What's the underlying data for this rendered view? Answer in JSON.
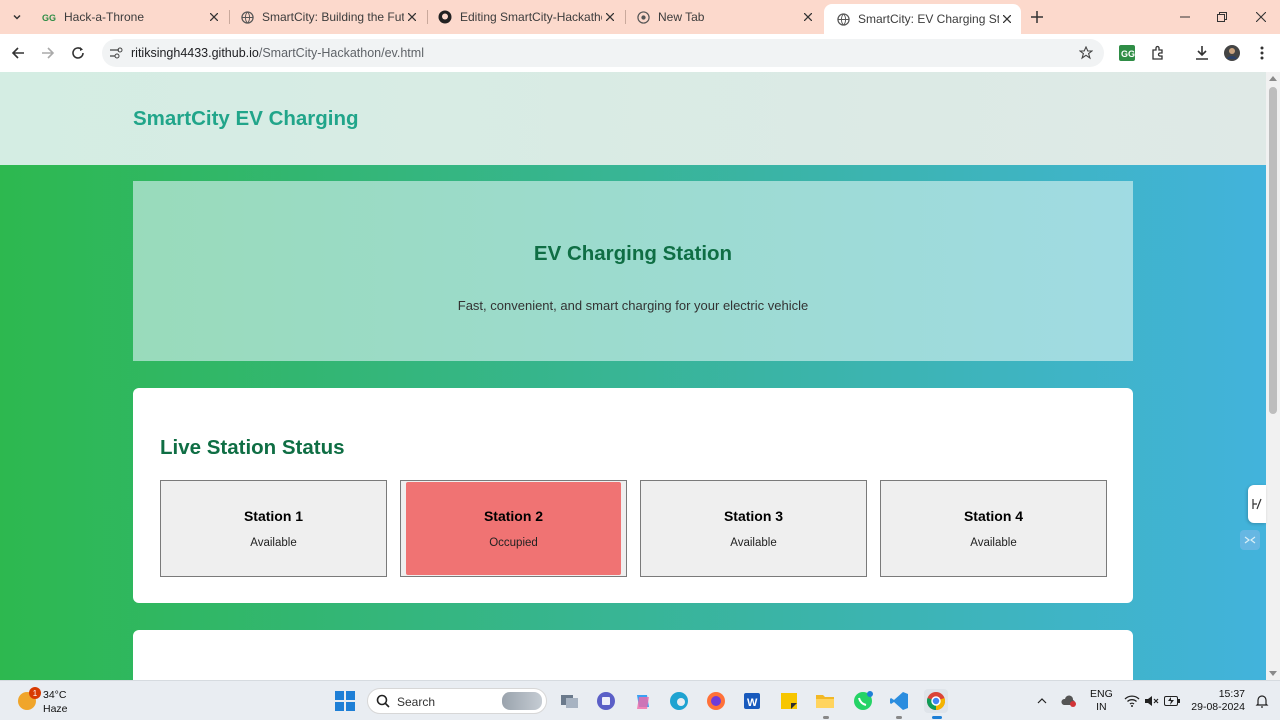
{
  "browser": {
    "tabs": [
      {
        "title": "Hack-a-Throne",
        "favicon": "gfg-icon"
      },
      {
        "title": "SmartCity: Building the Future",
        "favicon": "globe-icon"
      },
      {
        "title": "Editing SmartCity-Hackathon/R",
        "favicon": "github-icon"
      },
      {
        "title": "New Tab",
        "favicon": "chrome-icon"
      },
      {
        "title": "SmartCity: EV Charging Station",
        "favicon": "globe-icon",
        "active": true
      }
    ],
    "url_host": "ritiksingh4433.github.io",
    "url_path": "/SmartCity-Hackathon/ev.html"
  },
  "page": {
    "site_title": "SmartCity EV Charging",
    "hero_title": "EV Charging Station",
    "hero_subtitle": "Fast, convenient, and smart charging for your electric vehicle",
    "status_title": "Live Station Status",
    "stations": [
      {
        "name": "Station 1",
        "status": "Available"
      },
      {
        "name": "Station 2",
        "status": "Occupied"
      },
      {
        "name": "Station 3",
        "status": "Available"
      },
      {
        "name": "Station 4",
        "status": "Available"
      }
    ],
    "colors": {
      "accent": "#21a58a",
      "heading": "#0f6e44",
      "occupied": "#f07373"
    }
  },
  "taskbar": {
    "weather_temp": "34°C",
    "weather_cond": "Haze",
    "weather_badge": "1",
    "search_label": "Search",
    "lang_line1": "ENG",
    "lang_line2": "IN",
    "time": "15:37",
    "date": "29-08-2024"
  }
}
